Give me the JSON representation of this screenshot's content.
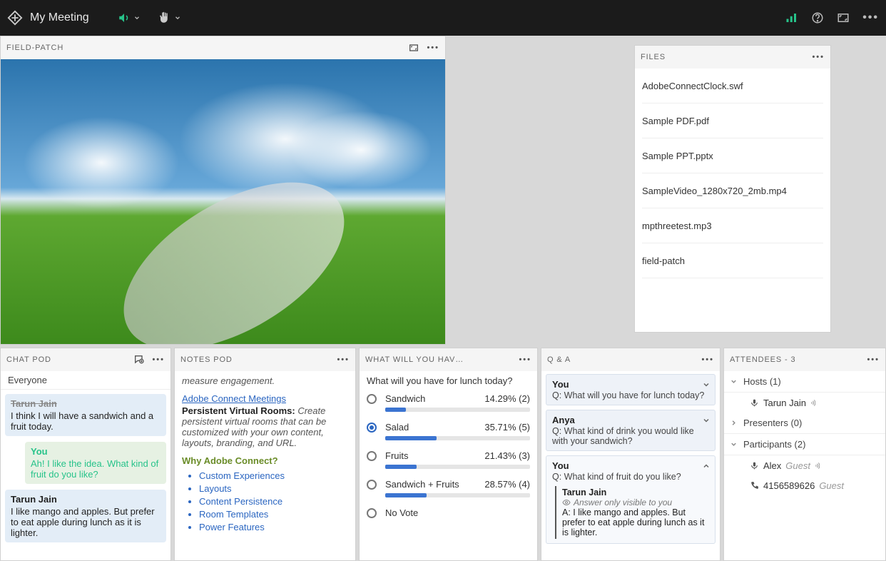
{
  "header": {
    "title": "My Meeting"
  },
  "share": {
    "title": "FIELD-PATCH"
  },
  "files": {
    "title": "FILES",
    "items": [
      "AdobeConnectClock.swf",
      "Sample PDF.pdf",
      "Sample PPT.pptx",
      "SampleVideo_1280x720_2mb.mp4",
      "mpthreetest.mp3",
      "field-patch"
    ]
  },
  "chat": {
    "title": "CHAT POD",
    "tab": "Everyone",
    "messages": [
      {
        "author": "Tarun Jain",
        "authorStruck": true,
        "text": "I think I will have a sandwich and a fruit today.",
        "cls": "blue"
      },
      {
        "author": "You",
        "text": "Ah! I like the idea. What kind of fruit do you like?",
        "cls": "green"
      },
      {
        "author": "Tarun Jain",
        "text": "I like mango and apples. But prefer to eat apple during lunch as it is lighter.",
        "cls": "blue"
      }
    ]
  },
  "notes": {
    "title": "NOTES POD",
    "preline": "measure engagement.",
    "linkTitle": "Adobe Connect Meetings",
    "boldLabel": "Persistent Virtual Rooms:",
    "boldText": " Create persistent virtual rooms that can be customized with your own content, layouts, branding, and URL.",
    "whyHeading": "Why Adobe Connect?",
    "bullets": [
      "Custom Experiences",
      "Layouts",
      "Content Persistence",
      "Room Templates",
      "Power Features"
    ]
  },
  "poll": {
    "title": "WHAT WILL YOU HAV…",
    "question": "What will you have for lunch today?",
    "options": [
      {
        "label": "Sandwich",
        "pct": "14.29% (2)",
        "bar": 14.29,
        "selected": false
      },
      {
        "label": "Salad",
        "pct": "35.71% (5)",
        "bar": 35.71,
        "selected": true
      },
      {
        "label": "Fruits",
        "pct": "21.43% (3)",
        "bar": 21.43,
        "selected": false
      },
      {
        "label": "Sandwich + Fruits",
        "pct": "28.57% (4)",
        "bar": 28.57,
        "selected": false
      },
      {
        "label": "No Vote",
        "pct": "",
        "bar": 0,
        "selected": false
      }
    ]
  },
  "qa": {
    "title": "Q & A",
    "items": [
      {
        "who": "You",
        "q": "Q: What will you have for lunch today?",
        "expanded": false
      },
      {
        "who": "Anya",
        "q": "Q: What kind of drink you would like with your sandwich?",
        "expanded": false
      },
      {
        "who": "You",
        "q": "Q: What kind of fruit do you like?",
        "expanded": true,
        "answer": {
          "name": "Tarun Jain",
          "hint": "Answer only visible to you",
          "text": "A: I like mango and apples. But prefer to eat apple during lunch as it is lighter."
        }
      }
    ]
  },
  "attendees": {
    "title": "ATTENDEES - 3",
    "groups": [
      {
        "label": "Hosts (1)",
        "open": true,
        "rows": [
          {
            "type": "mic",
            "name": "Tarun Jain",
            "suffix": "",
            "speaker": true
          }
        ]
      },
      {
        "label": "Presenters (0)",
        "open": false,
        "rows": []
      },
      {
        "label": "Participants (2)",
        "open": true,
        "rows": [
          {
            "type": "mic",
            "name": "Alex",
            "suffix": "Guest",
            "speaker": true
          },
          {
            "type": "phone",
            "name": "4156589626",
            "suffix": "Guest",
            "speaker": false
          }
        ]
      }
    ]
  }
}
